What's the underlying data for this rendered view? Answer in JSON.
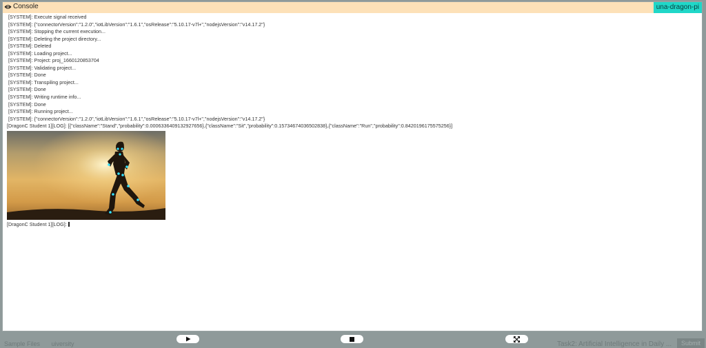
{
  "console": {
    "title": "Console",
    "device": "una-dragon-pi",
    "system_lines": [
      "[SYSTEM]: Execute signal received",
      "[SYSTEM]: {\"connectorVersion\":\"1.2.0\",\"iotLibVersion\":\"1.6.1\",\"osRelease\":\"5.10.17-v7l+\",\"nodejsVersion\":\"v14.17.2\"}",
      "[SYSTEM]: Stopping the current execution...",
      "[SYSTEM]: Deleting the project directory...",
      "[SYSTEM]: Deleted",
      "[SYSTEM]: Loading project...",
      "[SYSTEM]: Project: proj_1660120853704",
      "[SYSTEM]: Validating project...",
      "[SYSTEM]: Done",
      "[SYSTEM]: Transpiling project...",
      "[SYSTEM]: Done",
      "[SYSTEM]: Writing runtime info...",
      "[SYSTEM]: Done",
      "[SYSTEM]: Running project...",
      "[SYSTEM]: {\"connectorVersion\":\"1.2.0\",\"iotLibVersion\":\"1.6.1\",\"osRelease\":\"5.10.17-v7l+\",\"nodejsVersion\":\"v14.17.2\"}"
    ],
    "log_prediction": "[DragonC Student 1][LOG]: [{\"className\":\"Stand\",\"probability\":0.0006336409132927656},{\"className\":\"Sit\",\"probability\":0.15734674036502838},{\"className\":\"Run\",\"probability\":0.8420196175575256}]",
    "log_prompt": "[DragonC Student 1][LOG]:"
  },
  "toolbar": {
    "play_icon": "play-icon",
    "stop_icon": "stop-icon",
    "expand_icon": "expand-icon"
  },
  "backdrop": {
    "left_items": [
      "Sample Files",
      "uiversity"
    ],
    "right_text": "Task2: Artificial Intelligence in Daily ...",
    "right_button": "Submit"
  },
  "colors": {
    "header_bg": "#fde1b8",
    "badge_bg": "#20d7c8",
    "keypoint": "#33e3ff"
  }
}
